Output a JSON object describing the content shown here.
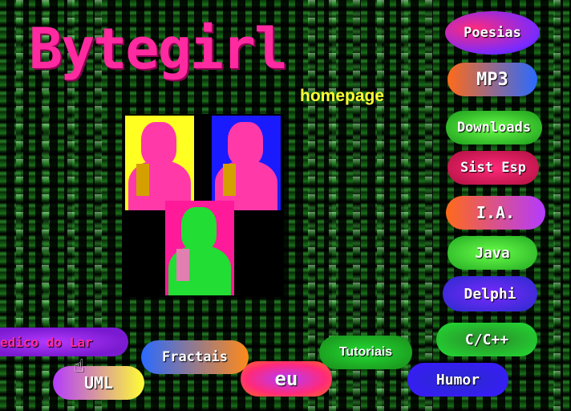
{
  "header": {
    "title": "Bytegirl",
    "subtitle": "homepage"
  },
  "colors": {
    "title": "#ff2aa0",
    "subtitle": "#ffff33",
    "matrix": "#3fa83f"
  },
  "nav": {
    "poesias": "Poesias",
    "mp3": "MP3",
    "downloads": "Downloads",
    "sist_esp": "Sist Esp",
    "ia": "I.A.",
    "java": "Java",
    "delphi": "Delphi",
    "c_cpp": "C/C++",
    "humor": "Humor",
    "tutoriais": "Tutoriais",
    "eu": "eu",
    "fractais": "Fractais",
    "uml": "UML",
    "medico": "edico do Lar"
  },
  "portraits": [
    "yellow-pink portrait",
    "blue-pink portrait",
    "pink-green portrait"
  ],
  "icons": {
    "cursor": "hand-pointer-icon"
  }
}
